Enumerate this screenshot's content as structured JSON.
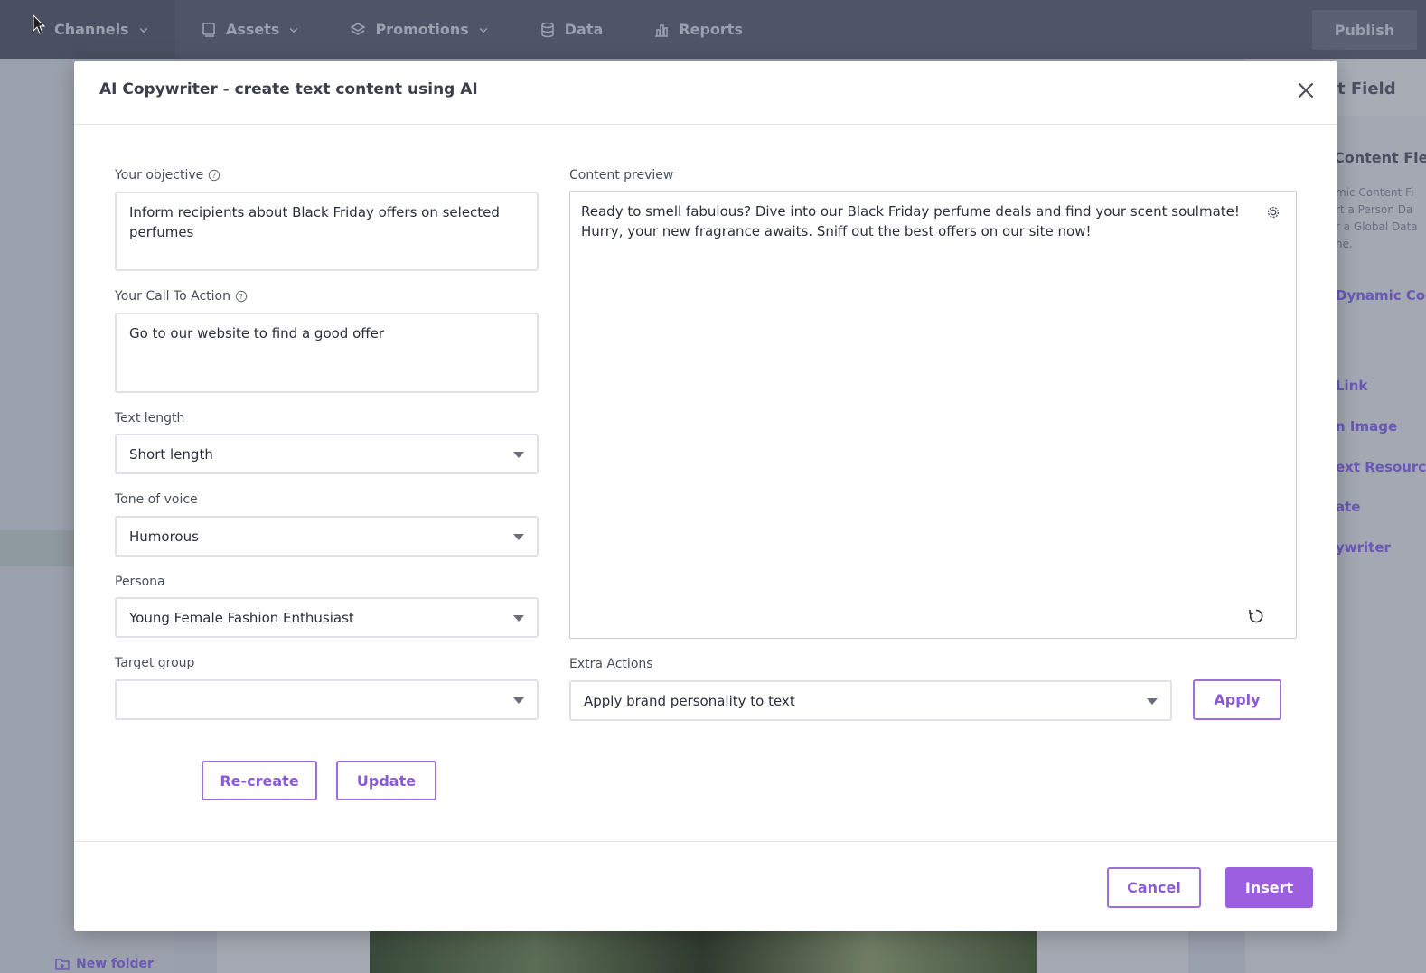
{
  "nav": {
    "items": [
      {
        "label": "Channels",
        "icon": "channels-icon",
        "dropdown": true
      },
      {
        "label": "Assets",
        "icon": "assets-icon",
        "dropdown": true
      },
      {
        "label": "Promotions",
        "icon": "layers-icon",
        "dropdown": true
      },
      {
        "label": "Data",
        "icon": "database-icon",
        "dropdown": false
      },
      {
        "label": "Reports",
        "icon": "bar-chart-icon",
        "dropdown": false
      }
    ],
    "publish_label": "Publish"
  },
  "background": {
    "new_folder_label": "New folder",
    "right_panel": {
      "title": "t Field",
      "subtitle": "Content Fiel",
      "desc_lines": [
        "mic Content Fi",
        "rt a Person Da",
        "r a Global Data",
        "ne."
      ],
      "links": [
        "Dynamic Co",
        "Link",
        "n Image",
        "ext Resourc",
        "ate",
        "ywriter"
      ]
    }
  },
  "modal": {
    "title": "AI Copywriter - create text content using AI",
    "objective": {
      "label": "Your objective",
      "value": " Inform recipients about Black Friday offers on selected perfumes"
    },
    "cta": {
      "label": "Your Call To Action",
      "value": "Go to our website to find a good offer"
    },
    "text_length": {
      "label": "Text length",
      "value": "Short length"
    },
    "tone": {
      "label": "Tone of voice",
      "value": "Humorous"
    },
    "persona": {
      "label": "Persona",
      "value": "Young Female Fashion Enthusiast"
    },
    "target_group": {
      "label": "Target group",
      "value": ""
    },
    "preview": {
      "label": "Content preview",
      "text": "Ready to smell fabulous? Dive into our Black Friday perfume deals and find your scent soulmate! Hurry, your new fragrance awaits. Sniff out the best offers on our site now!"
    },
    "extra_actions": {
      "label": "Extra Actions",
      "value": "Apply brand personality to text",
      "apply_label": "Apply"
    },
    "recreate_label": "Re-create",
    "update_label": "Update",
    "cancel_label": "Cancel",
    "insert_label": "Insert"
  },
  "colors": {
    "accent": "#9b5fe0",
    "nav_bg": "#4f5567",
    "overlay": "#9aa0ac"
  }
}
